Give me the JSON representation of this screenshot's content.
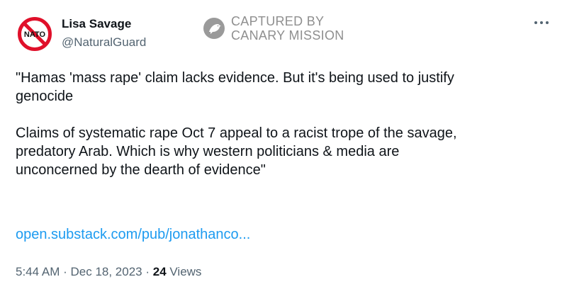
{
  "author": {
    "display_name": "Lisa Savage",
    "handle": "@NaturalGuard",
    "avatar_text": "NATO"
  },
  "watermark": {
    "line1": "CAPTURED BY",
    "line2": "CANARY MISSION"
  },
  "tweet": {
    "paragraph1_line1": "\"Hamas 'mass rape' claim lacks evidence. But it's being used to justify",
    "paragraph1_line2": "genocide",
    "paragraph2_line1": "Claims of systematic rape Oct 7 appeal to a racist trope of the savage,",
    "paragraph2_line2": "predatory Arab. Which is why western politicians & media are",
    "paragraph2_line3": "unconcerned by the dearth of evidence\"",
    "link_text": "open.substack.com/pub/jonathanco..."
  },
  "meta": {
    "time": "5:44 AM",
    "separator": " · ",
    "date": "Dec 18, 2023",
    "views_count": "24",
    "views_label": " Views"
  },
  "colors": {
    "link": "#1d9bf0",
    "secondary_text": "#536471",
    "primary_text": "#0f1419",
    "avatar_no_symbol": "#e0102a"
  },
  "icons": {
    "avatar": "nato-prohibited-sign-icon",
    "watermark": "canary-bird-icon",
    "more": "more-dots-icon"
  }
}
